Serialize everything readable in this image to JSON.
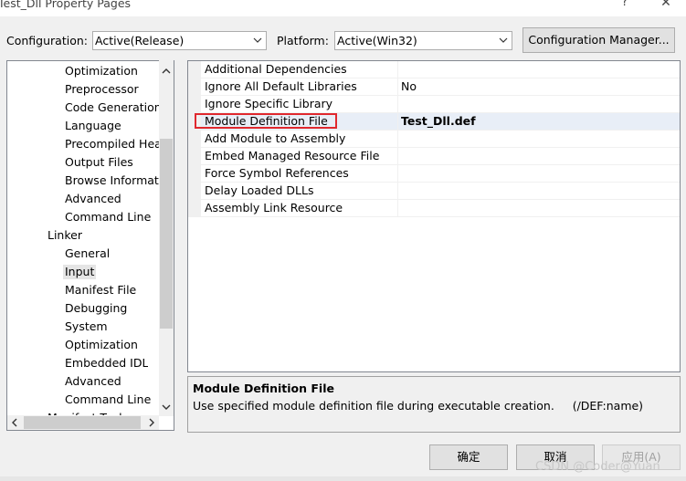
{
  "window": {
    "title": "Test_Dll Property Pages",
    "help_label": "?",
    "close_label": "✕"
  },
  "toolbar": {
    "configuration_label": "Configuration:",
    "configuration_value": "Active(Release)",
    "platform_label": "Platform:",
    "platform_value": "Active(Win32)",
    "config_manager_label": "Configuration Manager..."
  },
  "tree": {
    "items": [
      {
        "label": "Optimization",
        "level": 2
      },
      {
        "label": "Preprocessor",
        "level": 2
      },
      {
        "label": "Code Generation",
        "level": 2
      },
      {
        "label": "Language",
        "level": 2
      },
      {
        "label": "Precompiled Head",
        "level": 2
      },
      {
        "label": "Output Files",
        "level": 2
      },
      {
        "label": "Browse Informatio",
        "level": 2
      },
      {
        "label": "Advanced",
        "level": 2
      },
      {
        "label": "Command Line",
        "level": 2
      },
      {
        "label": "Linker",
        "level": 1
      },
      {
        "label": "General",
        "level": 2
      },
      {
        "label": "Input",
        "level": 2,
        "selected": true
      },
      {
        "label": "Manifest File",
        "level": 2
      },
      {
        "label": "Debugging",
        "level": 2
      },
      {
        "label": "System",
        "level": 2
      },
      {
        "label": "Optimization",
        "level": 2
      },
      {
        "label": "Embedded IDL",
        "level": 2
      },
      {
        "label": "Advanced",
        "level": 2
      },
      {
        "label": "Command Line",
        "level": 2
      },
      {
        "label": "Manifest Tool",
        "level": 1
      }
    ]
  },
  "properties": [
    {
      "name": "Additional Dependencies",
      "value": ""
    },
    {
      "name": "Ignore All Default Libraries",
      "value": "No"
    },
    {
      "name": "Ignore Specific Library",
      "value": ""
    },
    {
      "name": "Module Definition File",
      "value": "Test_Dll.def",
      "selected": true,
      "bold": true
    },
    {
      "name": "Add Module to Assembly",
      "value": ""
    },
    {
      "name": "Embed Managed Resource File",
      "value": ""
    },
    {
      "name": "Force Symbol References",
      "value": ""
    },
    {
      "name": "Delay Loaded DLLs",
      "value": ""
    },
    {
      "name": "Assembly Link Resource",
      "value": ""
    }
  ],
  "description": {
    "title": "Module Definition File",
    "text": "Use specified module definition file during executable creation.     (/DEF:name)"
  },
  "buttons": {
    "ok": "确定",
    "cancel": "取消",
    "apply": "应用(A)"
  },
  "watermark": "CSDN @Coder@Yuan",
  "colors": {
    "highlight_box": "#e0282e",
    "selected_row": "#e8eef7",
    "dialog_bg": "#f0f0f0"
  }
}
